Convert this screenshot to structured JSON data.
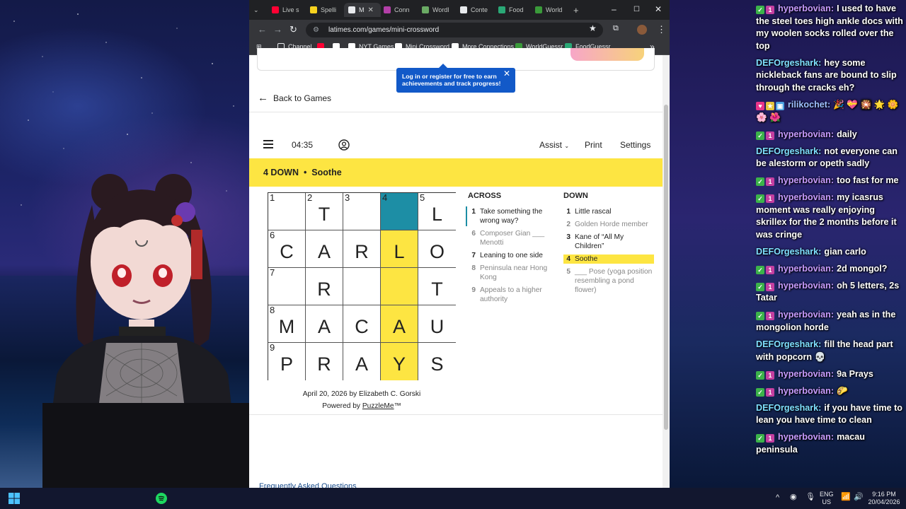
{
  "browser": {
    "tabs": [
      {
        "label": "Live s",
        "color": "#ff0033"
      },
      {
        "label": "Spelli",
        "color": "#f7d21e"
      },
      {
        "label": "M",
        "color": "#e8eaed",
        "active": true
      },
      {
        "label": "Conn",
        "color": "#b33fa8"
      },
      {
        "label": "Wordl",
        "color": "#6aaa64"
      },
      {
        "label": "Conte",
        "color": "#e8eaed"
      },
      {
        "label": "Food",
        "color": "#2aa876"
      },
      {
        "label": "World",
        "color": "#3a9a3a"
      }
    ],
    "new_tab": "+",
    "window_controls": {
      "minimize": "–",
      "maximize": "☐",
      "close": "✕"
    },
    "url": "latimes.com/games/mini-crossword",
    "bookmarks": [
      {
        "label": "Channel",
        "icon": "folder-icon"
      },
      {
        "label": "",
        "icon": "youtube-icon",
        "color": "#ff0033"
      },
      {
        "label": "",
        "icon": "x-icon",
        "color": "#ffffff"
      },
      {
        "label": "NYT Games",
        "icon": "nyt-icon",
        "color": "#ffffff"
      },
      {
        "label": "Mini Crossword",
        "icon": "latimes-icon",
        "color": "#ffffff"
      },
      {
        "label": "More Connections",
        "icon": "page-icon",
        "color": "#ffffff"
      },
      {
        "label": "WorldGuessr",
        "icon": "globe-icon",
        "color": "#3a9a3a"
      },
      {
        "label": "FoodGuessr",
        "icon": "food-icon",
        "color": "#2aa876"
      }
    ],
    "bookmarks_more": "»"
  },
  "page": {
    "tooltip": "Log in or register for free to earn achievements and track progress!",
    "back_label": "Back to Games",
    "timer": "04:35",
    "toolbar": {
      "assist": "Assist",
      "print": "Print",
      "settings": "Settings"
    },
    "current_clue": {
      "number": "4 DOWN",
      "text": "Soothe"
    },
    "grid": [
      [
        {
          "n": "1",
          "v": ""
        },
        {
          "n": "2",
          "v": "T"
        },
        {
          "n": "3",
          "v": ""
        },
        {
          "n": "4",
          "v": "",
          "state": "sel"
        },
        {
          "n": "5",
          "v": "L"
        }
      ],
      [
        {
          "n": "6",
          "v": "C"
        },
        {
          "n": "",
          "v": "A"
        },
        {
          "n": "",
          "v": "R"
        },
        {
          "n": "",
          "v": "L",
          "state": "hl"
        },
        {
          "n": "",
          "v": "O"
        }
      ],
      [
        {
          "n": "7",
          "v": ""
        },
        {
          "n": "",
          "v": "R"
        },
        {
          "n": "",
          "v": ""
        },
        {
          "n": "",
          "v": "",
          "state": "hl"
        },
        {
          "n": "",
          "v": "T"
        }
      ],
      [
        {
          "n": "8",
          "v": "M"
        },
        {
          "n": "",
          "v": "A"
        },
        {
          "n": "",
          "v": "C"
        },
        {
          "n": "",
          "v": "A",
          "state": "hl"
        },
        {
          "n": "",
          "v": "U"
        }
      ],
      [
        {
          "n": "9",
          "v": "P"
        },
        {
          "n": "",
          "v": "R"
        },
        {
          "n": "",
          "v": "A"
        },
        {
          "n": "",
          "v": "Y",
          "state": "hl"
        },
        {
          "n": "",
          "v": "S"
        }
      ]
    ],
    "across_title": "ACROSS",
    "down_title": "DOWN",
    "across": [
      {
        "n": "1",
        "t": "Take something the wrong way?",
        "state": "normal"
      },
      {
        "n": "6",
        "t": "Composer Gian ___ Menotti",
        "state": "dim"
      },
      {
        "n": "7",
        "t": "Leaning to one side",
        "state": "normal"
      },
      {
        "n": "8",
        "t": "Peninsula near Hong Kong",
        "state": "dim"
      },
      {
        "n": "9",
        "t": "Appeals to a higher authority",
        "state": "dim"
      }
    ],
    "down": [
      {
        "n": "1",
        "t": "Little rascal",
        "state": "normal"
      },
      {
        "n": "2",
        "t": "Golden Horde member",
        "state": "dim"
      },
      {
        "n": "3",
        "t": "Kane of “All My Children”",
        "state": "normal"
      },
      {
        "n": "4",
        "t": "Soothe",
        "state": "cur"
      },
      {
        "n": "5",
        "t": "___ Pose (yoga position resembling a pond flower)",
        "state": "dim"
      }
    ],
    "byline": "April 20, 2026 by Elizabeth C. Gorski",
    "powered_prefix": "Powered by",
    "powered_link": "PuzzleMe",
    "powered_suffix": "™",
    "faq": "Frequently Asked Questions"
  },
  "chat": [
    {
      "user": "hyperbovian",
      "badges": [
        "check",
        "sub"
      ],
      "text": "I used to have the steel toes high ankle docs with my woolen socks rolled over the top"
    },
    {
      "user": "DEFOrgeshark",
      "badges": [],
      "text": "hey some nickleback fans are bound to slip through the cracks eh?"
    },
    {
      "user": "rilikochet",
      "badges": [
        "heart",
        "star",
        "blue"
      ],
      "text": "🎉 💝 🎇 🌟 🌼 🌸 🌺"
    },
    {
      "user": "hyperbovian",
      "badges": [
        "check",
        "sub"
      ],
      "text": "daily"
    },
    {
      "user": "DEFOrgeshark",
      "badges": [],
      "text": "not everyone can be alestorm or opeth sadly"
    },
    {
      "user": "hyperbovian",
      "badges": [
        "check",
        "sub"
      ],
      "text": "too fast for me"
    },
    {
      "user": "hyperbovian",
      "badges": [
        "check",
        "sub"
      ],
      "text": "my icasrus moment was really enjoying skrillex for the 2 months before it was cringe"
    },
    {
      "user": "DEFOrgeshark",
      "badges": [],
      "text": "gian carlo"
    },
    {
      "user": "hyperbovian",
      "badges": [
        "check",
        "sub"
      ],
      "text": "2d mongol?"
    },
    {
      "user": "hyperbovian",
      "badges": [
        "check",
        "sub"
      ],
      "text": "oh 5 letters, 2s Tatar"
    },
    {
      "user": "hyperbovian",
      "badges": [
        "check",
        "sub"
      ],
      "text": "yeah as in the mongolion horde"
    },
    {
      "user": "DEFOrgeshark",
      "badges": [],
      "text": "fill the head part with popcorn 💀"
    },
    {
      "user": "hyperbovian",
      "badges": [
        "check",
        "sub"
      ],
      "text": "9a Prays"
    },
    {
      "user": "hyperbovian",
      "badges": [
        "check",
        "sub"
      ],
      "text": "🌮"
    },
    {
      "user": "DEFOrgeshark",
      "badges": [],
      "text": "if you have time to lean you have time to clean"
    },
    {
      "user": "hyperbovian",
      "badges": [
        "check",
        "sub"
      ],
      "text": "macau peninsula"
    }
  ],
  "taskbar": {
    "lang_top": "ENG",
    "lang_bottom": "US",
    "time": "9:16 PM",
    "date": "20/04/2026",
    "tray_chevron": "^"
  }
}
